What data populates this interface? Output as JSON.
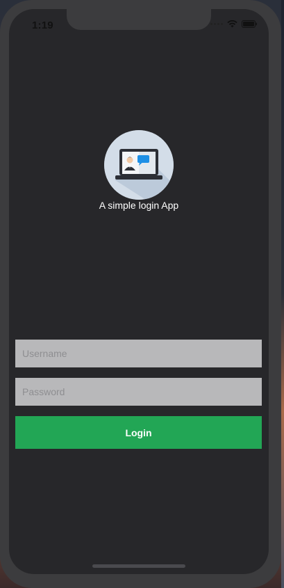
{
  "status_bar": {
    "time": "1:19",
    "icons": [
      "signal-icon",
      "wifi-icon",
      "battery-icon"
    ]
  },
  "header": {
    "logo_icon": "laptop-chat-icon",
    "tagline": "A simple login App"
  },
  "form": {
    "username_placeholder": "Username",
    "username_value": "",
    "password_placeholder": "Password",
    "password_value": "",
    "login_label": "Login"
  },
  "colors": {
    "screen_bg": "#27272a",
    "input_bg": "#b8b8ba",
    "login_button": "#22a655",
    "text": "#ffffff"
  }
}
